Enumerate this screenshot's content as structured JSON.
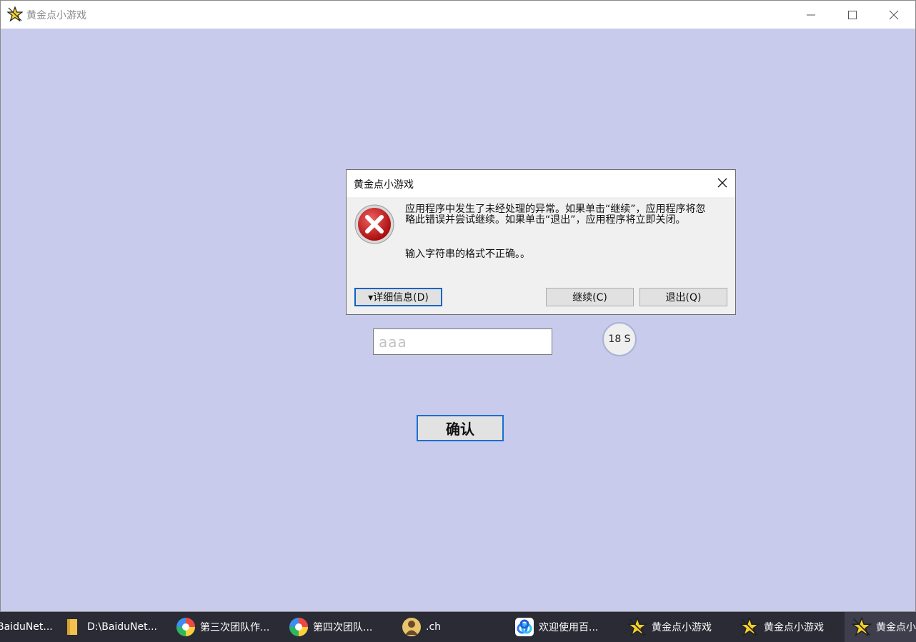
{
  "window": {
    "title": "黄金点小游戏"
  },
  "main": {
    "input_placeholder": "aaa",
    "timer": "18 S",
    "confirm_label": "确认"
  },
  "dialog": {
    "title": "黄金点小游戏",
    "message": "应用程序中发生了未经处理的异常。如果单击“继续”，应用程序将忽略此错误并尝试继续。如果单击“退出”，应用程序将立即关闭。",
    "detail": "输入字符串的格式不正确。。",
    "details_button": "▾详细信息(D)",
    "continue_button": "继续(C)",
    "quit_button": "退出(Q)"
  },
  "taskbar": {
    "items": [
      {
        "label": "BaiduNet...",
        "icon": "baidu-folder-icon"
      },
      {
        "label": "D:\\BaiduNet...",
        "icon": "folder-icon"
      },
      {
        "label": "第三次团队作...",
        "icon": "browser-icon"
      },
      {
        "label": "第四次团队...",
        "icon": "browser-icon"
      },
      {
        "label": ".ch",
        "icon": "avatar-icon"
      },
      {
        "label": "欢迎使用百...",
        "icon": "baidu-netdisk-icon"
      },
      {
        "label": "黄金点小游戏",
        "icon": "star-app-icon"
      },
      {
        "label": "黄金点小游戏",
        "icon": "star-app-icon"
      },
      {
        "label": "黄金点小",
        "icon": "star-app-icon"
      }
    ]
  },
  "colors": {
    "window_bg": "#c9cbec",
    "accent": "#1c6ed1",
    "taskbar": "#2b2b36"
  }
}
